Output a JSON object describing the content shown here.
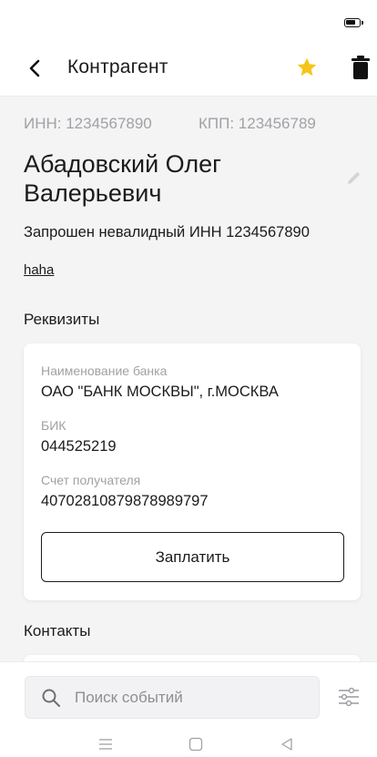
{
  "header": {
    "title": "Контрагент"
  },
  "counterparty": {
    "inn": "ИНН: 1234567890",
    "kpp": "КПП: 123456789",
    "name": "Абадовский Олег Валерьевич",
    "warning": "Запрошен невалидный ИНН 1234567890",
    "link": "haha"
  },
  "requisites": {
    "title": "Реквизиты",
    "bank_label": "Наименование банка",
    "bank_value": "ОАО \"БАНК МОСКВЫ\", г.МОСКВА",
    "bik_label": "БИК",
    "bik_value": "044525219",
    "account_label": "Счет получателя",
    "account_value": "40702810879878989797",
    "pay_button": "Заплатить"
  },
  "contacts": {
    "title": "Контакты"
  },
  "search": {
    "placeholder": "Поиск событий"
  },
  "icons": {
    "back": "arrow-back-icon",
    "favorite": "star-icon",
    "delete": "trash-icon",
    "edit": "pencil-icon",
    "search": "search-icon",
    "filter": "filter-sliders-icon",
    "battery": "battery-icon"
  },
  "colors": {
    "accent_star": "#f5c518",
    "muted_text": "#a1a1a6",
    "background": "#f4f4f5"
  }
}
